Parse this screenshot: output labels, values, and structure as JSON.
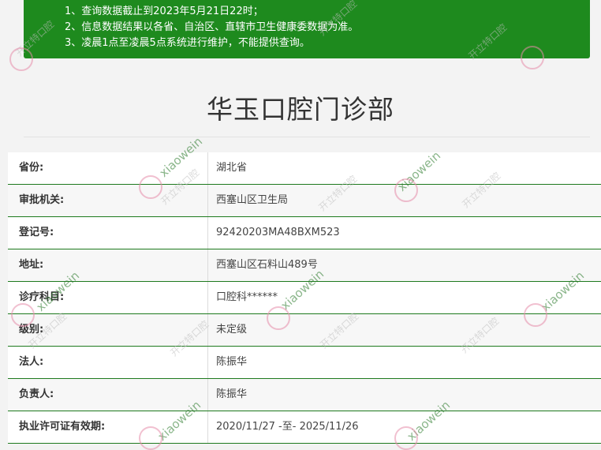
{
  "notice": {
    "lines": [
      "1、查询数据截止到2023年5月21日22时；",
      "2、信息数据结果以各省、自治区、直辖市卫生健康委数据为准。",
      "3、凌晨1点至凌晨5点系统进行维护，不能提供查询。"
    ]
  },
  "clinic": {
    "name": "华玉口腔门诊部"
  },
  "details": [
    {
      "label": "省份:",
      "value": "湖北省"
    },
    {
      "label": "审批机关:",
      "value": "西塞山区卫生局"
    },
    {
      "label": "登记号:",
      "value": "92420203MA48BXM523"
    },
    {
      "label": "地址:",
      "value": "西塞山区石料山489号"
    },
    {
      "label": "诊疗科目:",
      "value": "口腔科******"
    },
    {
      "label": "级别:",
      "value": "未定级"
    },
    {
      "label": "法人:",
      "value": "陈振华"
    },
    {
      "label": "负责人:",
      "value": "陈振华"
    },
    {
      "label": "执业许可证有效期:",
      "value": "2020/11/27 -至- 2025/11/26"
    }
  ],
  "watermarks": {
    "text": "xiaowein",
    "logo_text": "开立特口腔"
  }
}
